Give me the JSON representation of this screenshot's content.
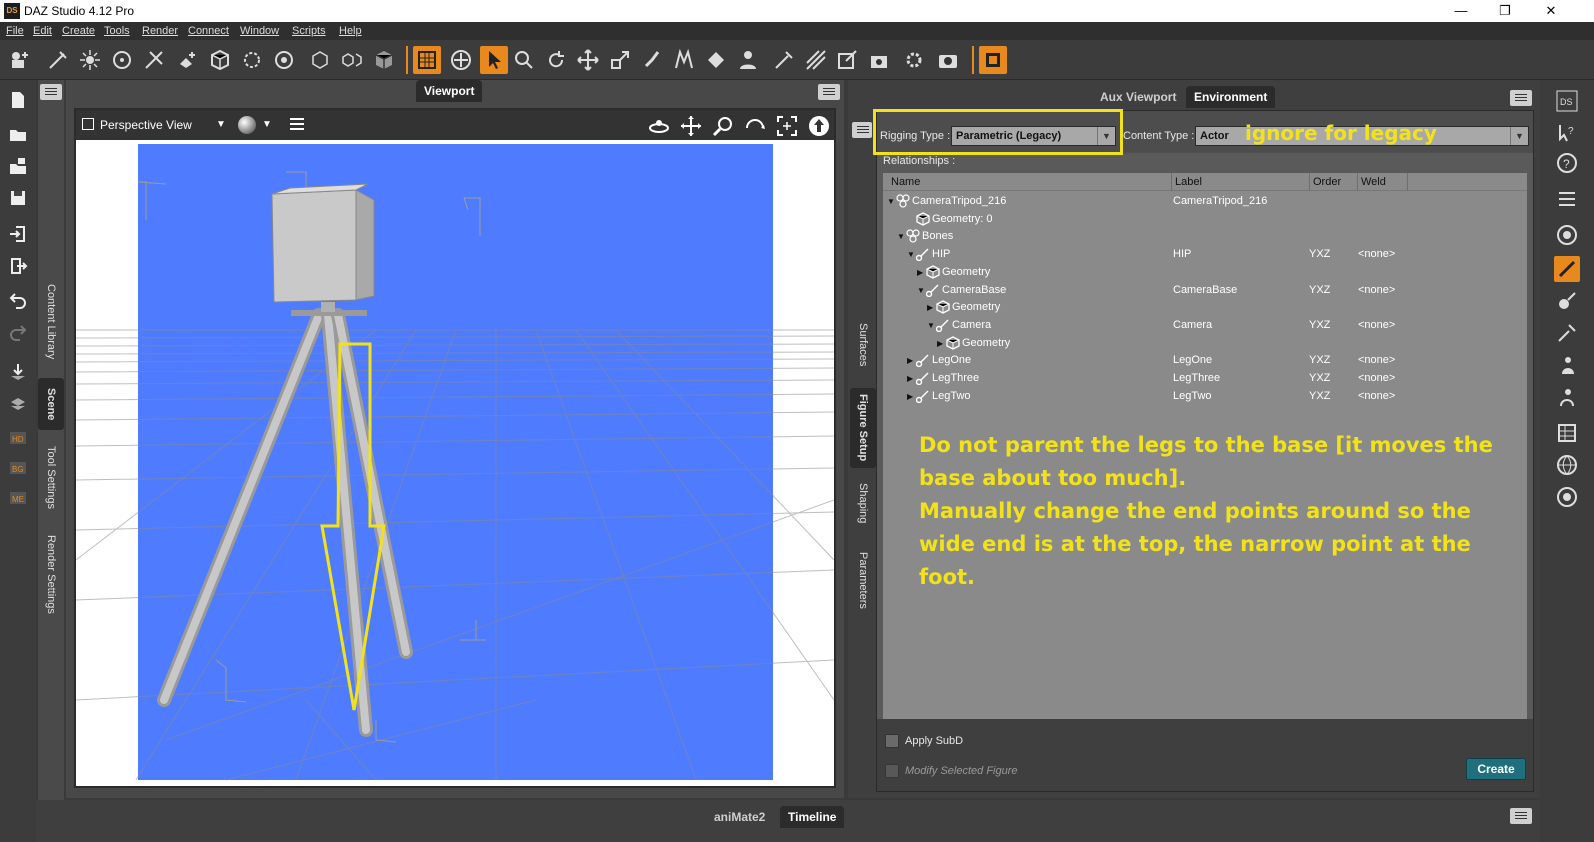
{
  "window": {
    "title": "DAZ Studio 4.12 Pro",
    "logo": "DS",
    "controls": [
      "—",
      "❐",
      "✕"
    ]
  },
  "menu": [
    "File",
    "Edit",
    "Create",
    "Tools",
    "Render",
    "Connect",
    "Window",
    "Scripts",
    "Help"
  ],
  "left_tabs": [
    "Content Library",
    "Scene",
    "Tool Settings",
    "Render Settings"
  ],
  "viewport": {
    "tab_label": "Viewport",
    "view_name": "Perspective View",
    "background_color": "#4f7cff"
  },
  "right_panel": {
    "tabs": [
      "Aux Viewport",
      "Environment"
    ],
    "active_tab": "Environment",
    "side_tabs": [
      "Surfaces",
      "Figure Setup",
      "Shaping",
      "Parameters"
    ],
    "rigging_type_label": "Rigging Type :",
    "rigging_type_value": "Parametric (Legacy)",
    "content_type_label": "Content Type :",
    "content_type_value": "Actor",
    "relationships_label": "Relationships :",
    "columns": [
      "Name",
      "Label",
      "Order",
      "Weld"
    ],
    "rows": [
      {
        "twisty": "▼",
        "icon": "figure-icon",
        "name": "CameraTripod_216",
        "label": "CameraTripod_216",
        "order": "",
        "weld": ""
      },
      {
        "twisty": "",
        "icon": "geometry-icon",
        "name": "Geometry: 0",
        "label": "",
        "order": "",
        "weld": ""
      },
      {
        "twisty": "▼",
        "icon": "figure-icon",
        "name": "Bones",
        "label": "",
        "order": "",
        "weld": ""
      },
      {
        "twisty": "▼",
        "icon": "bone-icon",
        "name": "HIP",
        "label": "HIP",
        "order": "YXZ",
        "weld": "<none>"
      },
      {
        "twisty": "▶",
        "icon": "geometry-icon",
        "name": "Geometry",
        "label": "",
        "order": "",
        "weld": ""
      },
      {
        "twisty": "▼",
        "icon": "bone-icon",
        "name": "CameraBase",
        "label": "CameraBase",
        "order": "YXZ",
        "weld": "<none>"
      },
      {
        "twisty": "▶",
        "icon": "geometry-icon",
        "name": "Geometry",
        "label": "",
        "order": "",
        "weld": ""
      },
      {
        "twisty": "▼",
        "icon": "bone-icon",
        "name": "Camera",
        "label": "Camera",
        "order": "YXZ",
        "weld": "<none>"
      },
      {
        "twisty": "▶",
        "icon": "geometry-icon",
        "name": "Geometry",
        "label": "",
        "order": "",
        "weld": ""
      },
      {
        "twisty": "▶",
        "icon": "bone-icon",
        "name": "LegOne",
        "label": "LegOne",
        "order": "YXZ",
        "weld": "<none>"
      },
      {
        "twisty": "▶",
        "icon": "bone-icon",
        "name": "LegThree",
        "label": "LegThree",
        "order": "YXZ",
        "weld": "<none>"
      },
      {
        "twisty": "▶",
        "icon": "bone-icon",
        "name": "LegTwo",
        "label": "LegTwo",
        "order": "YXZ",
        "weld": "<none>"
      }
    ],
    "apply_subd_label": "Apply SubD",
    "modify_selected_label": "Modify Selected Figure",
    "create_label": "Create"
  },
  "annotations": {
    "ignore_note": "ignore for legacy",
    "instructions": [
      "Do not parent the legs to the base [it moves the",
      "base about too much].",
      "Manually change the end points around so the",
      "wide end is at the top, the narrow point at the",
      "foot."
    ],
    "highlight_color": "#f2e21a"
  },
  "bottom_tabs": [
    "aniMate2",
    "Timeline"
  ],
  "bottom_active": "Timeline",
  "colors": {
    "accent": "#e8891e",
    "create_button": "#1f6f7d",
    "annotation": "#f2e21a"
  }
}
